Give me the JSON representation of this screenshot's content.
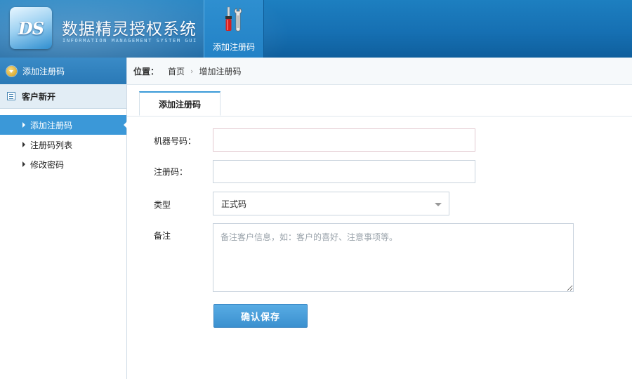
{
  "header": {
    "logo_text": "DS",
    "title": "数据精灵授权系统",
    "subtitle": "INFORMATION MANAGEMENT SYSTEM GUI",
    "nav_item": {
      "label": "添加注册码",
      "icon": "tools-icon"
    }
  },
  "sidebar": {
    "head": "添加注册码",
    "group": "客户新开",
    "items": [
      {
        "label": "添加注册码",
        "active": true
      },
      {
        "label": "注册码列表",
        "active": false
      },
      {
        "label": "修改密码",
        "active": false
      }
    ]
  },
  "breadcrumb": {
    "label": "位置：",
    "home": "首页",
    "separator": "›",
    "current": "增加注册码"
  },
  "tab": {
    "label": "添加注册码"
  },
  "form": {
    "machine_label": "机器号码：",
    "machine_value": "",
    "reg_label": "注册码：",
    "reg_value": "",
    "type_label": "类型",
    "type_value": "正式码",
    "note_label": "备注",
    "note_placeholder": "备注客户信息，如：客户的喜好、注意事项等。",
    "submit_label": "确认保存"
  },
  "colors": {
    "header_blue": "#1670b3",
    "sidebar_active": "#3b98d8",
    "button_blue": "#3b90cf"
  }
}
